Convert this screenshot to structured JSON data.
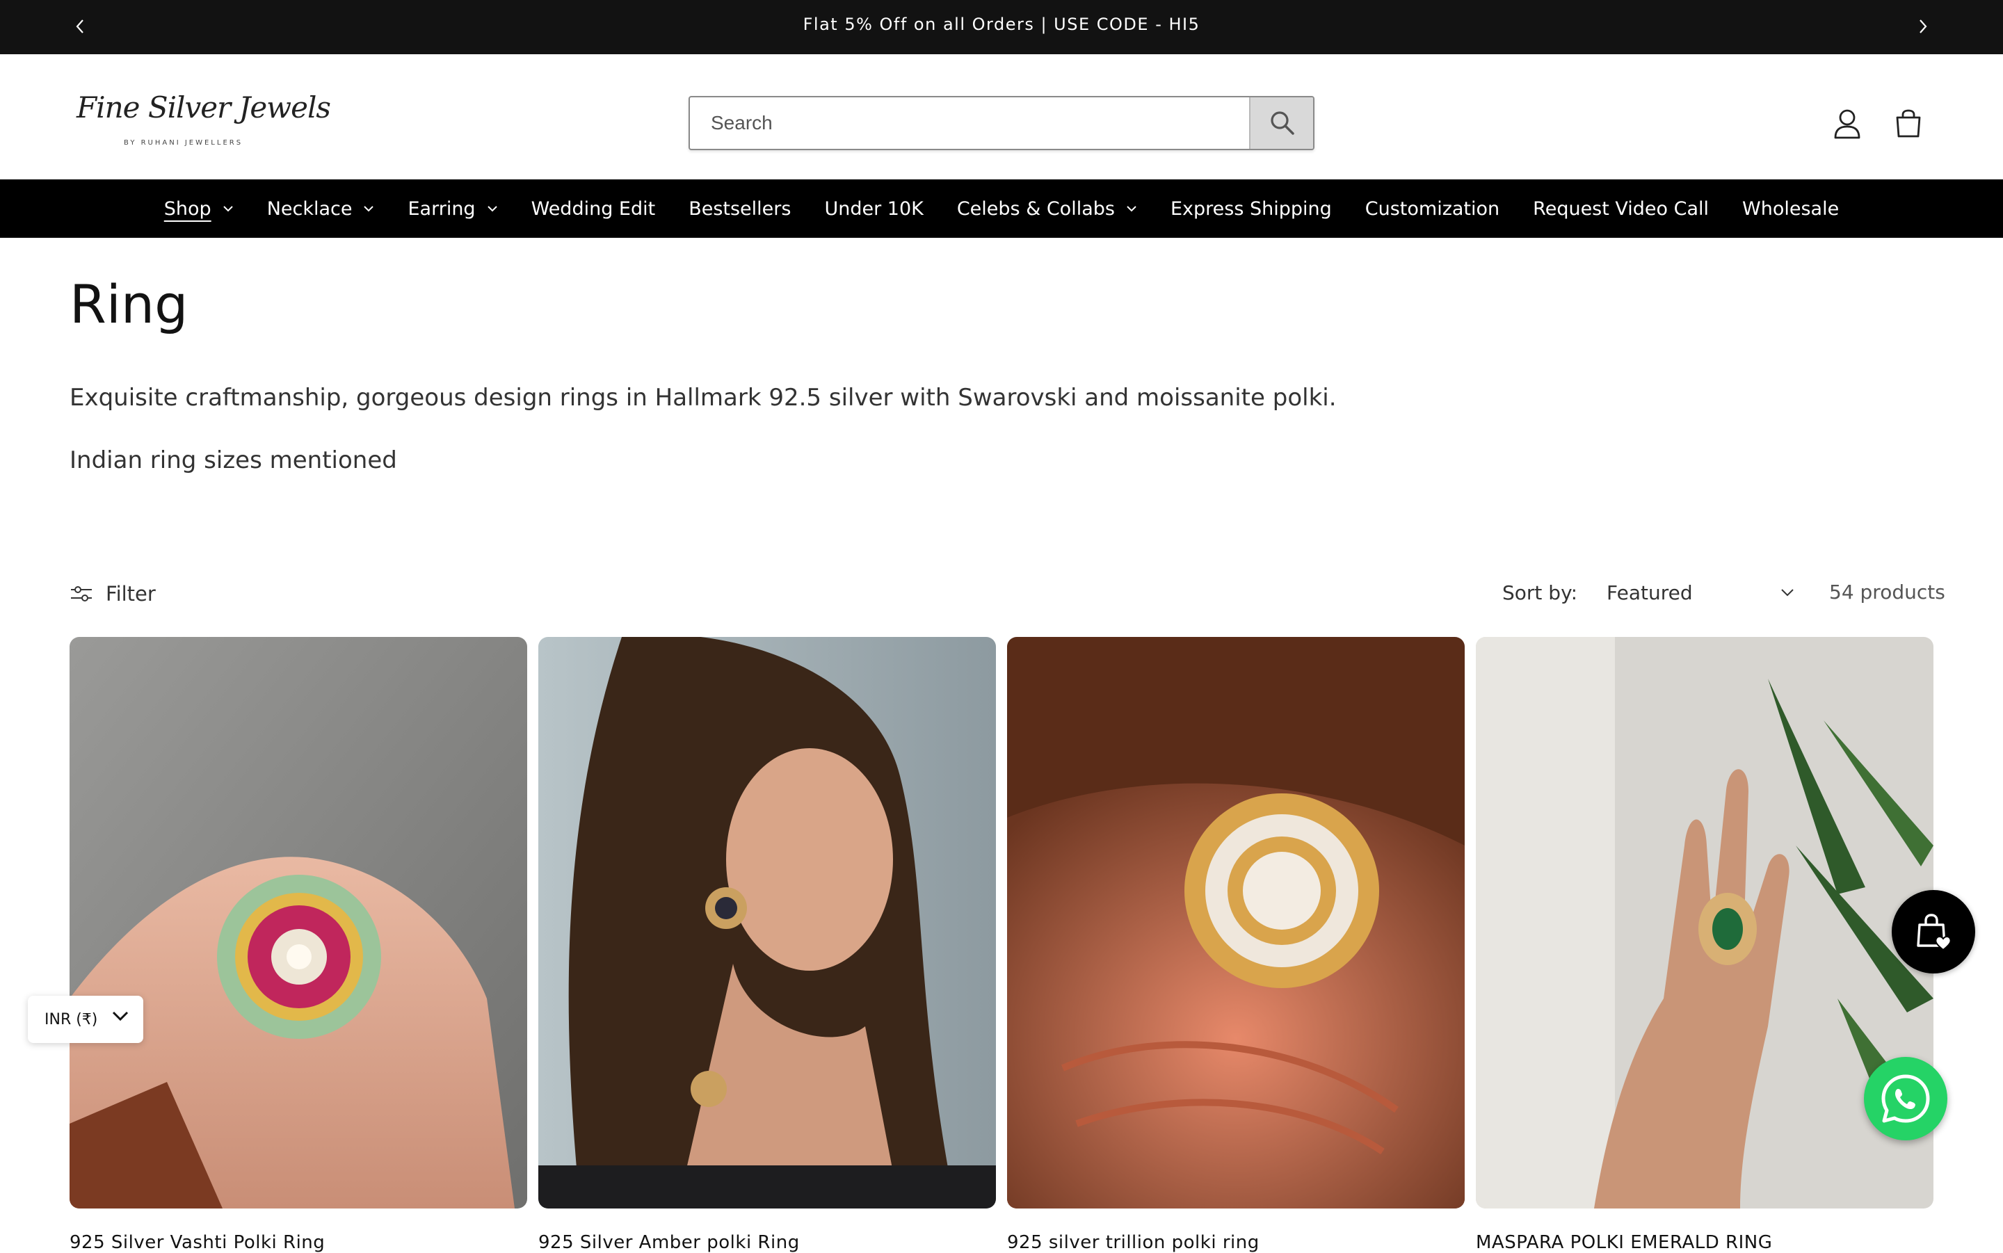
{
  "announcement": {
    "message": "Flat 5% Off on all Orders | USE CODE - HI5",
    "prev_icon": "chevron-left-icon",
    "next_icon": "chevron-right-icon"
  },
  "header": {
    "logo_text": "Fine Silver Jewels",
    "logo_subtext": "BY RUHANI JEWELLERS",
    "search_placeholder": "Search",
    "search_icon": "search-icon",
    "account_icon": "user-icon",
    "cart_icon": "shopping-bag-icon"
  },
  "nav": {
    "items": [
      {
        "label": "Shop",
        "has_dropdown": true,
        "active": true
      },
      {
        "label": "Necklace",
        "has_dropdown": true
      },
      {
        "label": "Earring",
        "has_dropdown": true
      },
      {
        "label": "Wedding Edit",
        "has_dropdown": false
      },
      {
        "label": "Bestsellers",
        "has_dropdown": false
      },
      {
        "label": "Under 10K",
        "has_dropdown": false
      },
      {
        "label": "Celebs & Collabs",
        "has_dropdown": true
      },
      {
        "label": "Express Shipping",
        "has_dropdown": false
      },
      {
        "label": "Customization",
        "has_dropdown": false
      },
      {
        "label": "Request Video Call",
        "has_dropdown": false
      },
      {
        "label": "Wholesale",
        "has_dropdown": false
      }
    ]
  },
  "collection": {
    "title": "Ring",
    "description_1": "Exquisite craftmanship, gorgeous design rings in Hallmark 92.5 silver with Swarovski and moissanite polki.",
    "description_2": "Indian ring sizes mentioned"
  },
  "toolbar": {
    "filter_label": "Filter",
    "sort_label": "Sort by:",
    "sort_selected": "Featured",
    "product_count": "54 products"
  },
  "products": [
    {
      "name": "925 Silver Vashti Polki Ring"
    },
    {
      "name": "925 Silver Amber polki Ring"
    },
    {
      "name": "925 silver trillion polki ring"
    },
    {
      "name": "MASPARA POLKI EMERALD RING"
    }
  ],
  "widgets": {
    "currency": "INR (₹)",
    "wishlist_icon": "wishlist-bag-heart-icon",
    "whatsapp_icon": "whatsapp-icon"
  },
  "colors": {
    "bar_dark": "#121212",
    "nav_bg": "#000000",
    "whatsapp": "#25d366"
  }
}
